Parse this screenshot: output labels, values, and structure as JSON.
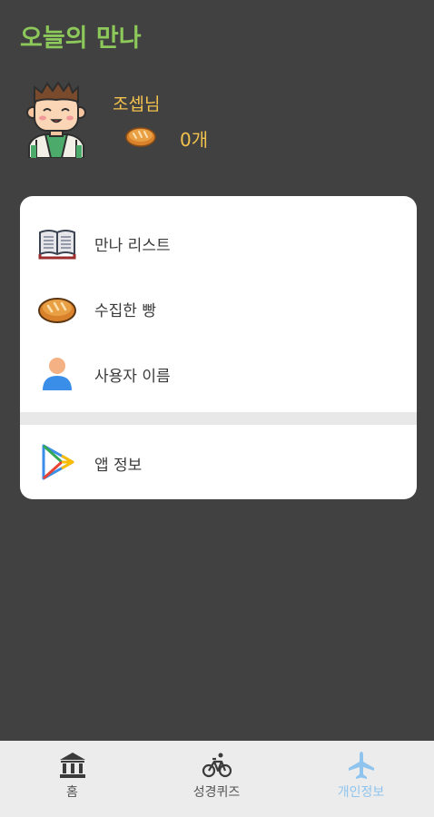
{
  "app": {
    "title": "오늘의 만나"
  },
  "profile": {
    "name": "조셉님",
    "bread_count": "0개"
  },
  "menu": {
    "items": [
      {
        "label": "만나 리스트",
        "icon": "book-icon"
      },
      {
        "label": "수집한 빵",
        "icon": "bread-icon"
      },
      {
        "label": "사용자 이름",
        "icon": "user-icon"
      }
    ],
    "extra": {
      "label": "앱 정보",
      "icon": "play-store-icon"
    }
  },
  "tabs": [
    {
      "label": "홈",
      "icon": "bank-icon",
      "active": false
    },
    {
      "label": "성경퀴즈",
      "icon": "bicycle-icon",
      "active": false
    },
    {
      "label": "개인정보",
      "icon": "airplane-icon",
      "active": true
    }
  ],
  "colors": {
    "background": "#414141",
    "title": "#8cc85a",
    "accent": "#f2c14e",
    "active_tab": "#8fc4ee",
    "tabbar": "#ececec"
  }
}
